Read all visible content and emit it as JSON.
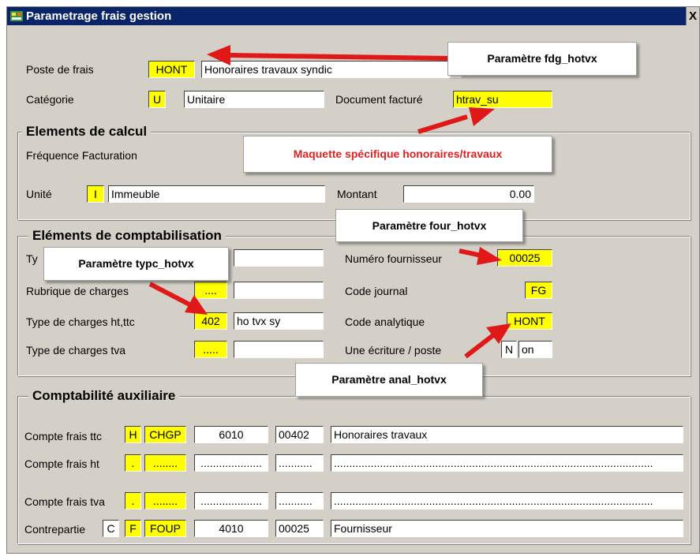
{
  "window": {
    "title": "Parametrage frais gestion",
    "close_glyph": "X"
  },
  "top": {
    "poste_label": "Poste de frais",
    "poste_code": "HONT",
    "poste_desc": "Honoraires travaux syndic",
    "categorie_label": "Catégorie",
    "categorie_code": "U",
    "categorie_desc": "Unitaire",
    "doc_label": "Document facturé",
    "doc_value": "htrav_su"
  },
  "calcul": {
    "title": "Elements de calcul",
    "frequence_label": "Fréquence Facturation",
    "unite_label": "Unité",
    "unite_code": "I",
    "unite_desc": "Immeuble",
    "montant_label": "Montant",
    "montant_value": "0.00"
  },
  "compta": {
    "title": "Eléments de comptabilisation",
    "ty_label": "Ty",
    "rubrique_label": "Rubrique de charges",
    "rubrique_code": "....",
    "type_ht_label": "Type de charges ht,ttc",
    "type_ht_code": "402",
    "type_ht_desc": "ho tvx sy",
    "type_tva_label": "Type de charges tva",
    "type_tva_code": ".....",
    "fournisseur_label": "Numéro fournisseur",
    "fournisseur_value": "00025",
    "journal_label": "Code journal",
    "journal_value": "FG",
    "analytique_label": "Code analytique",
    "analytique_value": "HONT",
    "ecriture_label": "Une écriture / poste",
    "ecriture_code": "N",
    "ecriture_desc": "on"
  },
  "auxiliaire": {
    "title": "Comptabilité auxiliaire",
    "rows": [
      {
        "label": "Compte frais ttc",
        "c1": "H",
        "c2": "CHGP",
        "c3": "6010",
        "c4": "00402",
        "c5": "Honoraires travaux"
      },
      {
        "label": "Compte frais ht",
        "c1": ".",
        "c2": "........",
        "c3": "....................",
        "c4": "...........",
        "c5": "........................................................................................................"
      },
      {
        "label": "Compte frais tva",
        "c1": ".",
        "c2": "........",
        "c3": "....................",
        "c4": "...........",
        "c5": "........................................................................................................"
      },
      {
        "label": "Contrepartie",
        "c0": "C",
        "c1": "F",
        "c2": "FOUP",
        "c3": "4010",
        "c4": "00025",
        "c5": "Fournisseur"
      }
    ]
  },
  "callouts": {
    "fdg": "Paramètre fdg_hotvx",
    "maquette": "Maquette spécifique honoraires/travaux",
    "four": "Paramètre four_hotvx",
    "typc": "Paramètre typc_hotvx",
    "anal": "Paramètre anal_hotvx"
  },
  "colors": {
    "highlight": "#ffff00",
    "arrow": "#e01818",
    "titlebar": "#0a246a",
    "dialog": "#d4d0c8"
  }
}
